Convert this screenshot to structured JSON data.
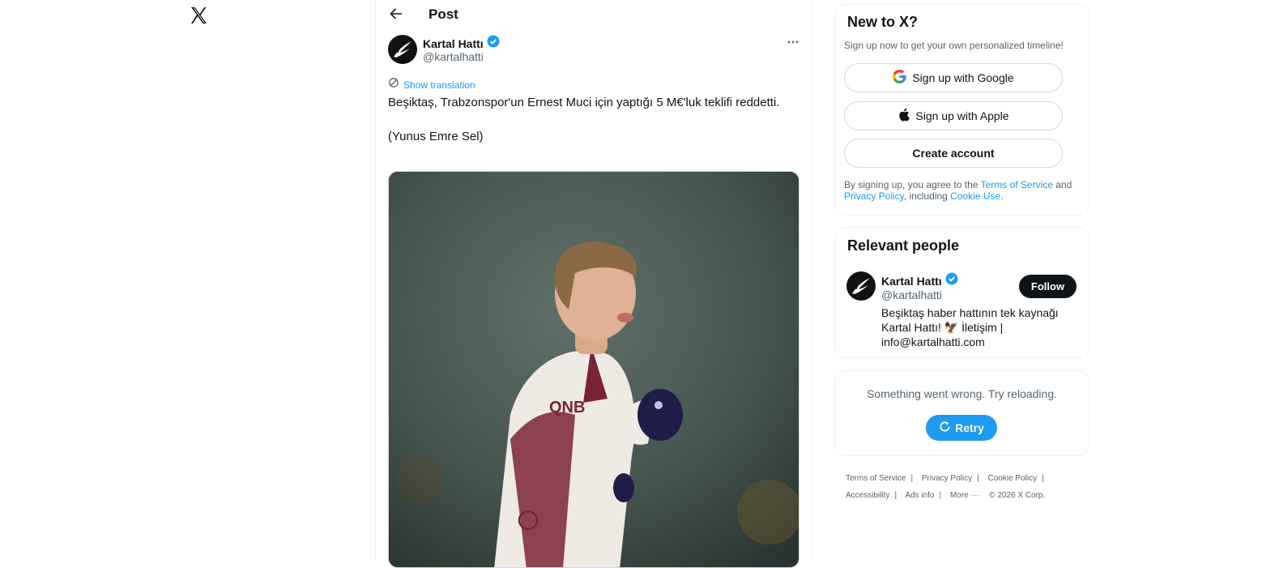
{
  "nav": {
    "logo_icon": "x-logo-icon"
  },
  "header": {
    "title": "Post",
    "back_icon": "arrow-left-icon"
  },
  "post": {
    "author_name": "Kartal Hattı",
    "author_handle": "@kartalhatti",
    "verified_icon": "verified-badge-icon",
    "more_icon": "more-horizontal-icon",
    "translate_label": "Show translation",
    "text": "Beşiktaş, Trabzonspor'un Ernest Muci için yaptığı 5 M€'luk teklifi reddetti.\n\n(Yunus Emre Sel)",
    "image_icon": "player-photo"
  },
  "signup": {
    "title": "New to X?",
    "subtitle": "Sign up now to get your own personalized timeline!",
    "google_label": "Sign up with Google",
    "apple_label": "Sign up with Apple",
    "create_label": "Create account",
    "terms_prefix": "By signing up, you agree to the ",
    "terms_link": "Terms of Service",
    "terms_and": " and ",
    "privacy_link": "Privacy Policy",
    "including": ", including ",
    "cookie_link": "Cookie Use",
    "period": "."
  },
  "relevant": {
    "title": "Relevant people",
    "name": "Kartal Hattı",
    "handle": "@kartalhatti",
    "follow_label": "Follow",
    "bio": "Beşiktaş haber hattının tek kaynağı Kartal Hattı! 🦅 İletişim | info@kartalhatti.com"
  },
  "error": {
    "message": "Something went wrong. Try reloading.",
    "retry_label": "Retry"
  },
  "footer": {
    "links": [
      "Terms of Service",
      "Privacy Policy",
      "Cookie Policy",
      "Accessibility",
      "Ads info",
      "More ···"
    ],
    "copyright": "© 2026 X Corp."
  },
  "colors": {
    "accent": "#1d9bf0",
    "text": "#0f1419",
    "muted": "#536471",
    "border": "#eff3f4"
  }
}
